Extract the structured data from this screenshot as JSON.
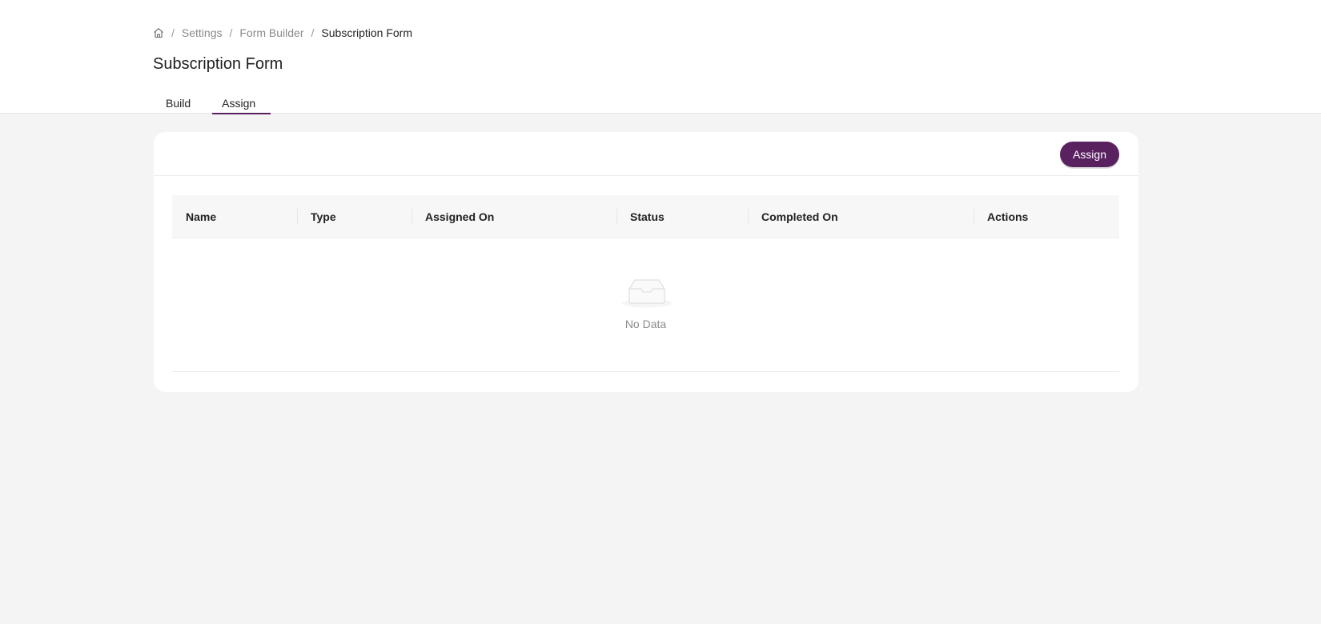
{
  "breadcrumb": {
    "home_icon": "home-icon",
    "items": [
      "Settings",
      "Form Builder"
    ],
    "current": "Subscription Form",
    "separator": "/"
  },
  "page": {
    "title": "Subscription Form"
  },
  "tabs": [
    {
      "label": "Build",
      "active": false
    },
    {
      "label": "Assign",
      "active": true
    }
  ],
  "card": {
    "assign_button": "Assign",
    "table": {
      "columns": [
        "Name",
        "Type",
        "Assigned On",
        "Status",
        "Completed On",
        "Actions"
      ],
      "rows": [],
      "empty_text": "No Data",
      "empty_icon": "empty-inbox-icon"
    }
  },
  "colors": {
    "accent": "#5a2160",
    "background": "#f4f4f4",
    "card": "#ffffff"
  }
}
